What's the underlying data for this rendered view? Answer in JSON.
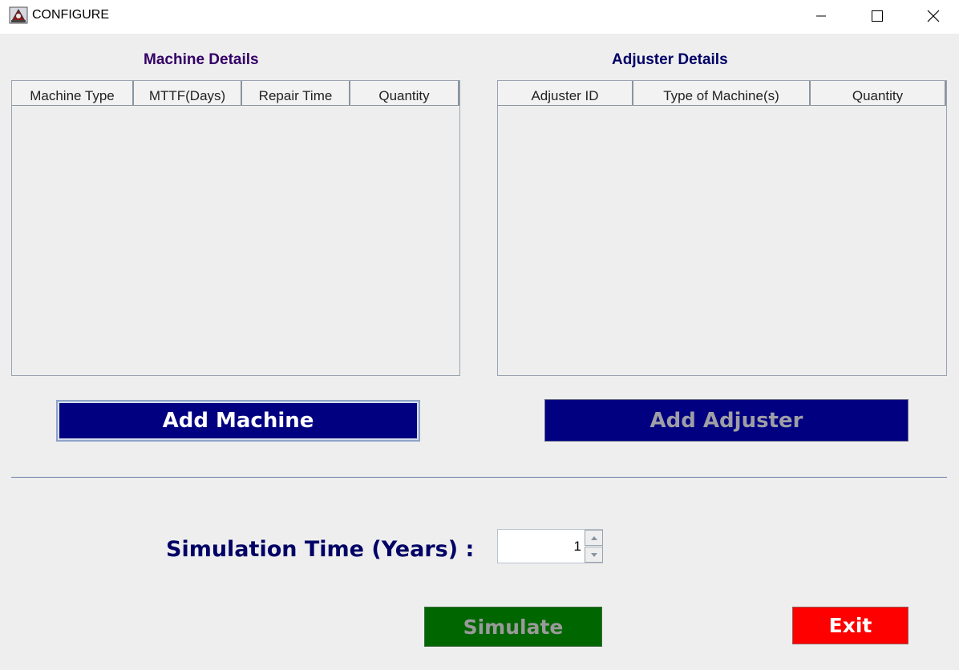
{
  "window": {
    "title": "CONFIGURE",
    "icons": [
      "app-icon",
      "minimize-icon",
      "maximize-icon",
      "close-icon"
    ]
  },
  "machine_section": {
    "title": "Machine Details",
    "columns": [
      "Machine Type",
      "MTTF(Days)",
      "Repair Time",
      "Quantity"
    ],
    "rows": [],
    "add_button_label": "Add Machine"
  },
  "adjuster_section": {
    "title": "Adjuster Details",
    "columns": [
      "Adjuster ID",
      "Type of Machine(s)",
      "Quantity"
    ],
    "rows": [],
    "add_button_label": "Add Adjuster",
    "add_button_enabled": false
  },
  "simulation": {
    "label": "Simulation Time (Years) :",
    "value": "1"
  },
  "actions": {
    "simulate_label": "Simulate",
    "simulate_enabled": false,
    "exit_label": "Exit"
  },
  "colors": {
    "navy_button": "#000080",
    "simulate_green": "#006600",
    "exit_red": "#ff0000",
    "machine_title": "#330066",
    "adjuster_title": "#000066"
  }
}
